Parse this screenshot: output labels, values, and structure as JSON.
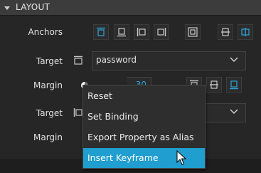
{
  "section": {
    "title": "LAYOUT"
  },
  "rows": {
    "anchors_label": "Anchors",
    "target1_label": "Target",
    "margin1_label": "Margin",
    "target2_label": "Target",
    "margin2_label": "Margin"
  },
  "target1": {
    "value": "password"
  },
  "margin1": {
    "value": "30"
  },
  "context_menu": {
    "items": [
      "Reset",
      "Set Binding",
      "Export Property as Alias",
      "Insert Keyframe"
    ],
    "highlighted_index": 3
  },
  "colors": {
    "accent": "#1f9ecf",
    "icon": "#c8c8c8",
    "icon_active": "#2ea6d9"
  }
}
